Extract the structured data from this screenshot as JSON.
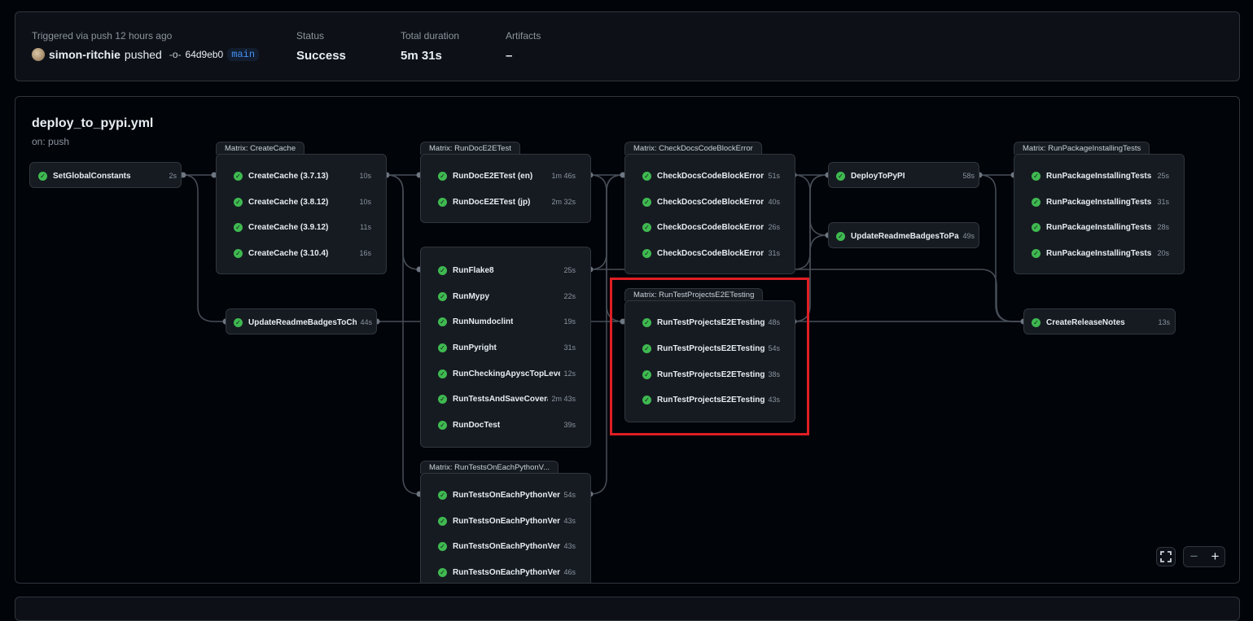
{
  "summary": {
    "trigger_text": "Triggered via push 12 hours ago",
    "user": "simon-ritchie",
    "action": "pushed",
    "commit": "64d9eb0",
    "branch": "main",
    "status_label": "Status",
    "status_value": "Success",
    "duration_label": "Total duration",
    "duration_value": "5m 31s",
    "artifacts_label": "Artifacts",
    "artifacts_value": "–"
  },
  "workflow": {
    "file": "deploy_to_pypi.yml",
    "trigger": "on: push"
  },
  "status_color": "#3fb950",
  "highlight_color": "#e01e24",
  "nodes": {
    "set_global": {
      "name": "SetGlobalConstants",
      "dur": "2s"
    },
    "create_cache": {
      "matrix": "Matrix: CreateCache",
      "jobs": [
        {
          "name": "CreateCache (3.7.13)",
          "dur": "10s"
        },
        {
          "name": "CreateCache (3.8.12)",
          "dur": "10s"
        },
        {
          "name": "CreateCache (3.9.12)",
          "dur": "11s"
        },
        {
          "name": "CreateCache (3.10.4)",
          "dur": "16s"
        }
      ]
    },
    "update_badges_ch": {
      "name": "UpdateReadmeBadgesToCh...",
      "dur": "44s"
    },
    "doc_e2e": {
      "matrix": "Matrix: RunDocE2ETest",
      "jobs": [
        {
          "name": "RunDocE2ETest (en)",
          "dur": "1m 46s"
        },
        {
          "name": "RunDocE2ETest (jp)",
          "dur": "2m 32s"
        }
      ]
    },
    "lint_group": {
      "jobs": [
        {
          "name": "RunFlake8",
          "dur": "25s"
        },
        {
          "name": "RunMypy",
          "dur": "22s"
        },
        {
          "name": "RunNumdoclint",
          "dur": "19s"
        },
        {
          "name": "RunPyright",
          "dur": "31s"
        },
        {
          "name": "RunCheckingApyscTopLevel...",
          "dur": "12s"
        },
        {
          "name": "RunTestsAndSaveCovera...",
          "dur": "2m 43s"
        },
        {
          "name": "RunDocTest",
          "dur": "39s"
        }
      ]
    },
    "each_python": {
      "matrix": "Matrix: RunTestsOnEachPythonV...",
      "jobs": [
        {
          "name": "RunTestsOnEachPythonVers...",
          "dur": "54s"
        },
        {
          "name": "RunTestsOnEachPythonVers...",
          "dur": "43s"
        },
        {
          "name": "RunTestsOnEachPythonVers...",
          "dur": "43s"
        },
        {
          "name": "RunTestsOnEachPythonVers...",
          "dur": "46s"
        }
      ]
    },
    "check_docs": {
      "matrix": "Matrix: CheckDocsCodeBlockError",
      "jobs": [
        {
          "name": "CheckDocsCodeBlockError (...",
          "dur": "51s"
        },
        {
          "name": "CheckDocsCodeBlockError (...",
          "dur": "40s"
        },
        {
          "name": "CheckDocsCodeBlockError (...",
          "dur": "26s"
        },
        {
          "name": "CheckDocsCodeBlockError (...",
          "dur": "31s"
        }
      ]
    },
    "e2e_projects": {
      "matrix": "Matrix: RunTestProjectsE2ETesting",
      "jobs": [
        {
          "name": "RunTestProjectsE2ETesting (...",
          "dur": "48s"
        },
        {
          "name": "RunTestProjectsE2ETesting (...",
          "dur": "54s"
        },
        {
          "name": "RunTestProjectsE2ETesting (...",
          "dur": "38s"
        },
        {
          "name": "RunTestProjectsE2ETesting (...",
          "dur": "43s"
        }
      ]
    },
    "deploy": {
      "name": "DeployToPyPI",
      "dur": "58s"
    },
    "update_badges_pa": {
      "name": "UpdateReadmeBadgesToPa...",
      "dur": "49s"
    },
    "package_install": {
      "matrix": "Matrix: RunPackageInstallingTests",
      "jobs": [
        {
          "name": "RunPackageInstallingTests (...",
          "dur": "25s"
        },
        {
          "name": "RunPackageInstallingTests (...",
          "dur": "31s"
        },
        {
          "name": "RunPackageInstallingTests (...",
          "dur": "28s"
        },
        {
          "name": "RunPackageInstallingTests (...",
          "dur": "20s"
        }
      ]
    },
    "release_notes": {
      "name": "CreateReleaseNotes",
      "dur": "13s"
    }
  },
  "controls": {
    "fullscreen_icon": "fullscreen-icon",
    "zoom_out": "−",
    "zoom_in": "+"
  }
}
